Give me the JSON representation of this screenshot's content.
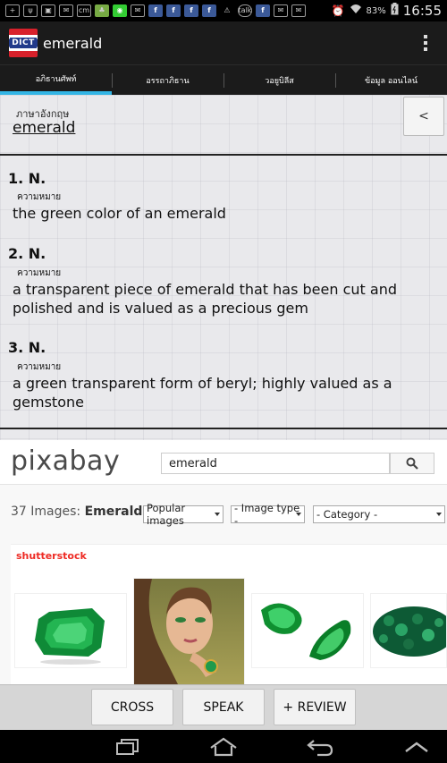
{
  "status_bar": {
    "icons": [
      "add-icon",
      "usb-icon",
      "image-icon",
      "mail-icon",
      "cm-icon",
      "game-icon",
      "line-icon",
      "mail-icon",
      "facebook-icon",
      "facebook-icon",
      "facebook-icon",
      "facebook-icon",
      "warning-icon",
      "talk-icon",
      "facebook-icon",
      "mail-icon",
      "mail-icon"
    ],
    "talk_label": "talk",
    "cm_label": "cm",
    "battery": "83%",
    "time": "16:55"
  },
  "action_bar": {
    "logo_text": "DICT",
    "title": "emerald"
  },
  "tabs": [
    {
      "label": "อภิธานศัพท์",
      "active": true
    },
    {
      "label": "อรรถาภิธาน",
      "active": false
    },
    {
      "label": "วอยูบิลีส",
      "active": false
    },
    {
      "label": "ข้อมูล ออนไลน์",
      "active": false
    }
  ],
  "entry": {
    "language_label": "ภาษาอังกฤษ",
    "headword": "emerald",
    "back_label": "<",
    "definitions": [
      {
        "number": "1. N.",
        "meaning_label": "ความหมาย",
        "text": "the green color of an emerald"
      },
      {
        "number": "2. N.",
        "meaning_label": "ความหมาย",
        "text": "a transparent piece of emerald that has been cut and polished and is valued as a precious gem"
      },
      {
        "number": "3. N.",
        "meaning_label": "ความหมาย",
        "text": "a green transparent form of beryl; highly valued as a gemstone"
      }
    ]
  },
  "web": {
    "logo": "pixabay",
    "search_value": "emerald",
    "results_count": "37 Images:",
    "results_query": "Emerald",
    "filters": {
      "sort": "Popular images",
      "image_type": "- Image type -",
      "category": "- Category -"
    },
    "sponsor": "shutterstock",
    "colors": {
      "emerald": "#0e9a3c",
      "shutterstock_red": "#ee2b24"
    }
  },
  "buttons": {
    "cross": "CROSS",
    "speak": "SPEAK",
    "review": "+ REVIEW"
  },
  "nav_bar": {
    "icons": [
      "recent-apps-icon",
      "home-icon",
      "back-icon",
      "menu-up-icon"
    ]
  }
}
